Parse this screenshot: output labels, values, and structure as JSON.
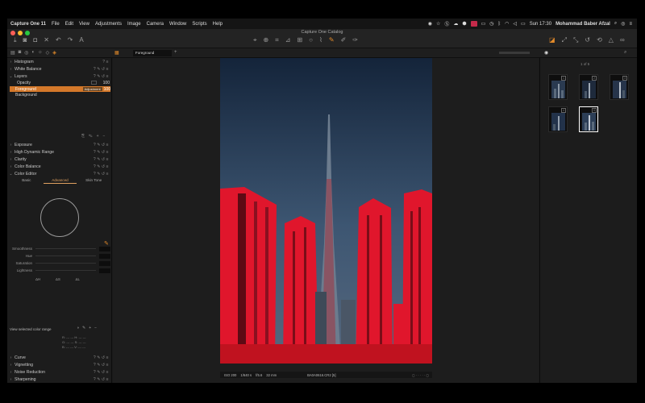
{
  "menubar": {
    "app_name": "Capture One 11",
    "items": [
      "File",
      "Edit",
      "View",
      "Adjustments",
      "Image",
      "Camera",
      "Window",
      "Scripts",
      "Help"
    ],
    "clock": "Sun 17:30",
    "user": "Mohammad Baber Afzal"
  },
  "window": {
    "title": "Capture One Catalog"
  },
  "subbar": {
    "layer_select": "Foreground"
  },
  "tools": {
    "histogram": "Histogram",
    "white_balance": "White Balance",
    "layers": "Layers",
    "opacity_label": "Opacity",
    "opacity_value": "100",
    "layer_foreground": "Foreground",
    "layer_foreground_badge": "Adjustment",
    "layer_foreground_value": "100",
    "layer_background": "Background",
    "exposure": "Exposure",
    "hdr": "High Dynamic Range",
    "clarity": "Clarity",
    "color_balance": "Color Balance",
    "color_editor": "Color Editor",
    "tab_basic": "Basic",
    "tab_advanced": "Advanced",
    "tab_skin": "Skin Tone",
    "smoothness": "Smoothness",
    "hue": "Hue",
    "saturation": "Saturation",
    "lightness": "Lightness",
    "delta_h": "ΔH",
    "delta_s": "ΔS",
    "delta_l": "ΔL",
    "view_selected": "View selected color range",
    "curve": "Curve",
    "vignetting": "Vignetting",
    "noise_reduction": "Noise Reduction",
    "sharpening": "Sharpening"
  },
  "rgb_readout": {
    "r_label": "R:",
    "g_label": "G:",
    "b_label": "B:",
    "h_label": "H:",
    "s_label": "S:",
    "v_label": "V:",
    "dash": "---"
  },
  "viewer": {
    "iso": "ISO 200",
    "shutter": "1/640 s",
    "aperture": "f/5.6",
    "focal": "32 mm",
    "filename": "BA0A0616.CR2 [5]"
  },
  "browser": {
    "count": "1 of 5",
    "thumbs": [
      "1",
      "2",
      "3",
      "4",
      "5"
    ]
  },
  "colors": {
    "accent": "#d4782a",
    "mask_red": "#e0162c"
  }
}
